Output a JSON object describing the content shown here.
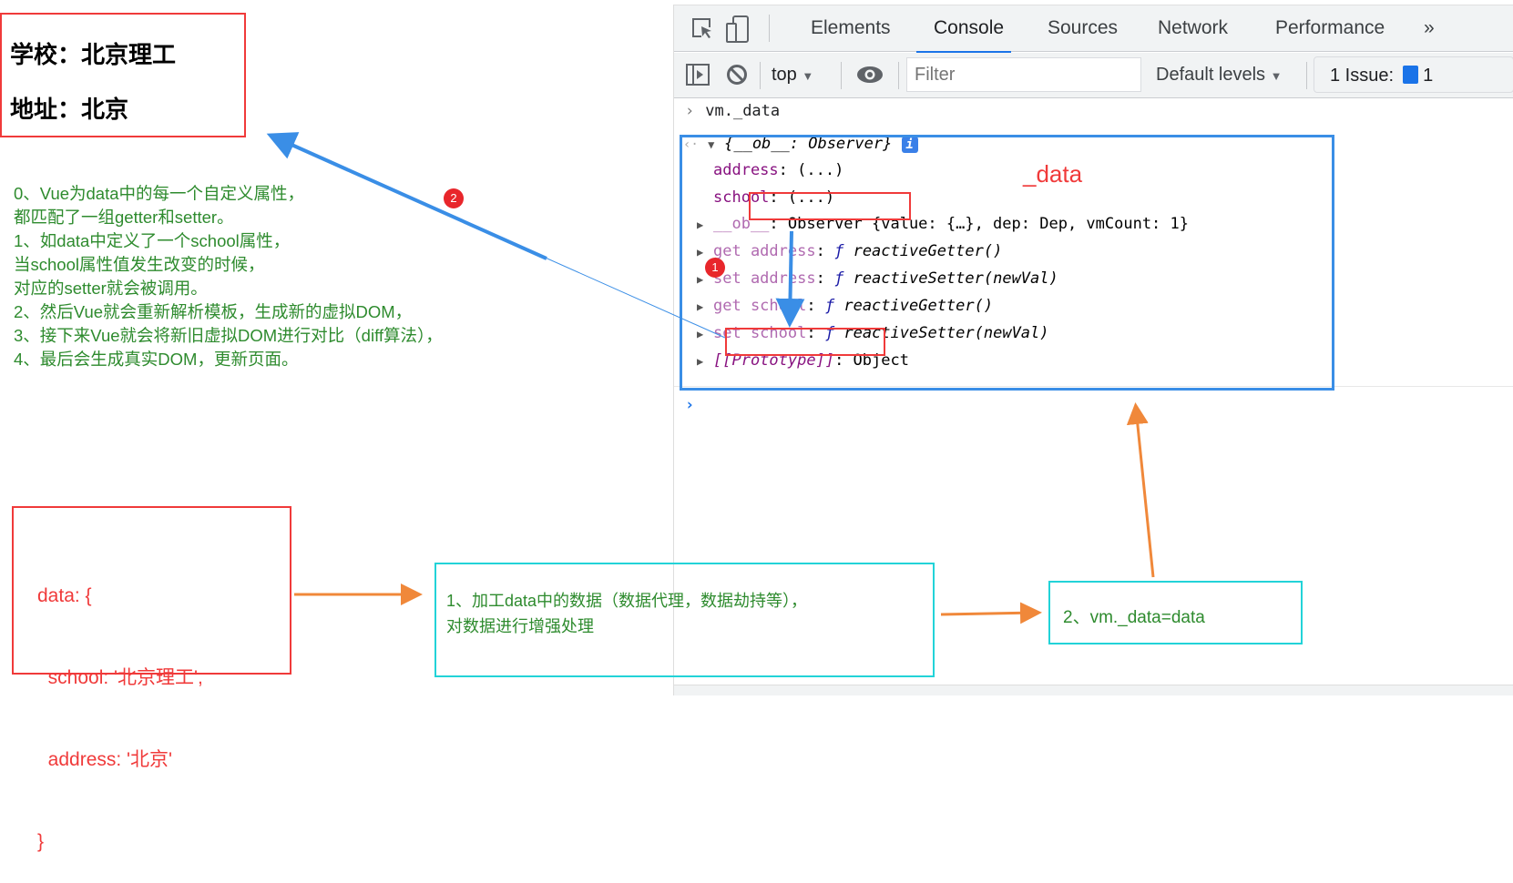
{
  "page": {
    "school_label": "学校：北京理工",
    "address_label": "地址：北京"
  },
  "notes": [
    "0、Vue为data中的每一个自定义属性，",
    "都匹配了一组getter和setter。",
    "1、如data中定义了一个school属性，",
    "当school属性值发生改变的时候，",
    "对应的setter就会被调用。",
    "2、然后Vue就会重新解析模板，生成新的虚拟DOM，",
    "3、接下来Vue就会将新旧虚拟DOM进行对比（diff算法），",
    "4、最后会生成真实DOM，更新页面。"
  ],
  "devtools": {
    "tabs": [
      "Elements",
      "Console",
      "Sources",
      "Network",
      "Performance"
    ],
    "active_tab": "Console",
    "more": "»",
    "context": "top",
    "filter_placeholder": "Filter",
    "levels": "Default levels",
    "issues_label": "1 Issue:",
    "issues_count": "1"
  },
  "console": {
    "command": "vm._data",
    "object_header": "{__ob__: Observer}",
    "rows": [
      {
        "key": "address",
        "value": ": (...)"
      },
      {
        "key": "school",
        "value": ": (...)"
      },
      {
        "key": "__ob__",
        "value": ": Observer {value: {…}, dep: Dep, vmCount: 1}"
      },
      {
        "key": "get address",
        "value": "reactiveGetter()"
      },
      {
        "key": "set address",
        "value": "reactiveSetter(newVal)"
      },
      {
        "key": "get school",
        "value": "reactiveGetter()"
      },
      {
        "key": "set school",
        "value": "reactiveSetter(newVal)"
      },
      {
        "key": "[[Prototype]]",
        "value": ": Object"
      }
    ],
    "f": "ƒ"
  },
  "annotations": {
    "data_label": "_data",
    "badge1": "1",
    "badge2": "2",
    "data_code": [
      "data: {",
      "  school: '北京理工',",
      "  address: '北京'",
      "}"
    ],
    "step1": [
      "1、加工data中的数据（数据代理，数据劫持等），",
      "对数据进行增强处理"
    ],
    "step2": "2、vm._data=data"
  },
  "colors": {
    "annotation_red": "#f03a3a",
    "annotation_blue": "#3a8ee6",
    "annotation_cyan": "#22d3d8",
    "arrow_orange": "#f0883a",
    "note_green": "#2e8b2e",
    "tab_active": "#1a73e8"
  }
}
